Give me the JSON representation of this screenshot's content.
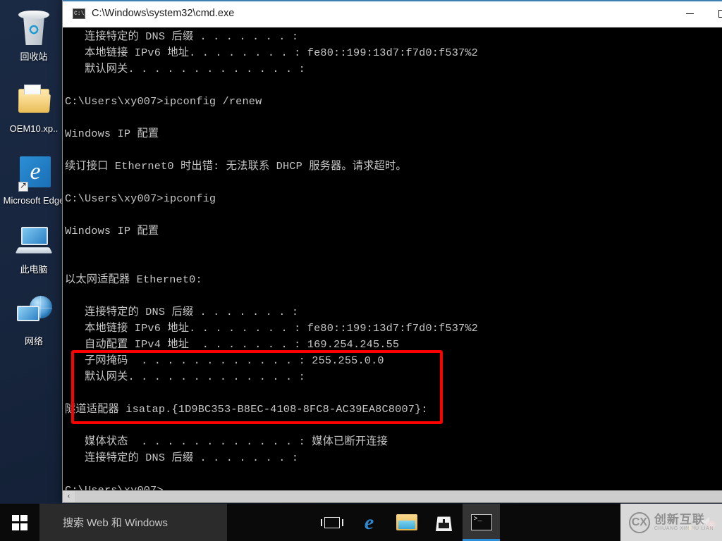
{
  "desktop": {
    "icons": [
      {
        "name": "recycle-bin",
        "label": "回收站"
      },
      {
        "name": "oem-folder",
        "label": "OEM10.xp.."
      },
      {
        "name": "microsoft-edge",
        "label": "Microsoft Edge"
      },
      {
        "name": "this-pc",
        "label": "此电脑"
      },
      {
        "name": "network",
        "label": "网络"
      }
    ]
  },
  "window": {
    "title": "C:\\Windows\\system32\\cmd.exe",
    "icon": "cmd-icon",
    "controls": {
      "minimize": "minimize-button",
      "maximize": "maximize-button"
    }
  },
  "console": {
    "prompt_user": "C:\\Users\\xy007>",
    "lines": [
      "   连接特定的 DNS 后缀 . . . . . . . :",
      "   本地链接 IPv6 地址. . . . . . . . : fe80::199:13d7:f7d0:f537%2",
      "   默认网关. . . . . . . . . . . . . :",
      "",
      "C:\\Users\\xy007>ipconfig /renew",
      "",
      "Windows IP 配置",
      "",
      "续订接口 Ethernet0 时出错: 无法联系 DHCP 服务器。请求超时。",
      "",
      "C:\\Users\\xy007>ipconfig",
      "",
      "Windows IP 配置",
      "",
      "",
      "以太网适配器 Ethernet0:",
      "",
      "   连接特定的 DNS 后缀 . . . . . . . :",
      "   本地链接 IPv6 地址. . . . . . . . : fe80::199:13d7:f7d0:f537%2",
      "   自动配置 IPv4 地址  . . . . . . . : 169.254.245.55",
      "   子网掩码  . . . . . . . . . . . . : 255.255.0.0",
      "   默认网关. . . . . . . . . . . . . :",
      "",
      "隧道适配器 isatap.{1D9BC353-B8EC-4108-8FC8-AC39EA8C8007}:",
      "",
      "   媒体状态  . . . . . . . . . . . . : 媒体已断开连接",
      "   连接特定的 DNS 后缀 . . . . . . . :",
      "",
      "C:\\Users\\xy007>"
    ],
    "highlight": {
      "label": "red-annotation-box",
      "color": "#ff0000",
      "covers": [
        "本地链接 IPv6 地址",
        "自动配置 IPv4 地址 : 169.254.245.55",
        "子网掩码 : 255.255.0.0",
        "默认网关"
      ]
    },
    "values": {
      "ipv6_link_local": "fe80::199:13d7:f7d0:f537%2",
      "ipv4_autoconfig": "169.254.245.55",
      "subnet_mask": "255.255.0.0",
      "default_gateway": "",
      "isatap_guid": "1D9BC353-B8EC-4108-8FC8-AC39EA8C8007",
      "media_state": "媒体已断开连接"
    },
    "scrollbar": {
      "left_arrow": "‹"
    }
  },
  "taskbar": {
    "start": "start-button",
    "search_placeholder": "搜索 Web 和 Windows",
    "buttons": [
      {
        "name": "task-view",
        "label": "任务视图"
      },
      {
        "name": "edge",
        "label": "Microsoft Edge",
        "glyph": "e"
      },
      {
        "name": "file-explorer",
        "label": "文件资源管理器"
      },
      {
        "name": "store",
        "label": "应用商店"
      },
      {
        "name": "command-prompt",
        "label": "命令提示符",
        "active": true
      }
    ],
    "tray": {
      "chevron": "⌃",
      "network_status": "network-warning",
      "volume_status": "volume-muted",
      "volume_badge": "✕"
    }
  },
  "watermark": {
    "mark": "CX",
    "cn": "创新互联",
    "en": "CHUANG XIN HU LIAN"
  }
}
